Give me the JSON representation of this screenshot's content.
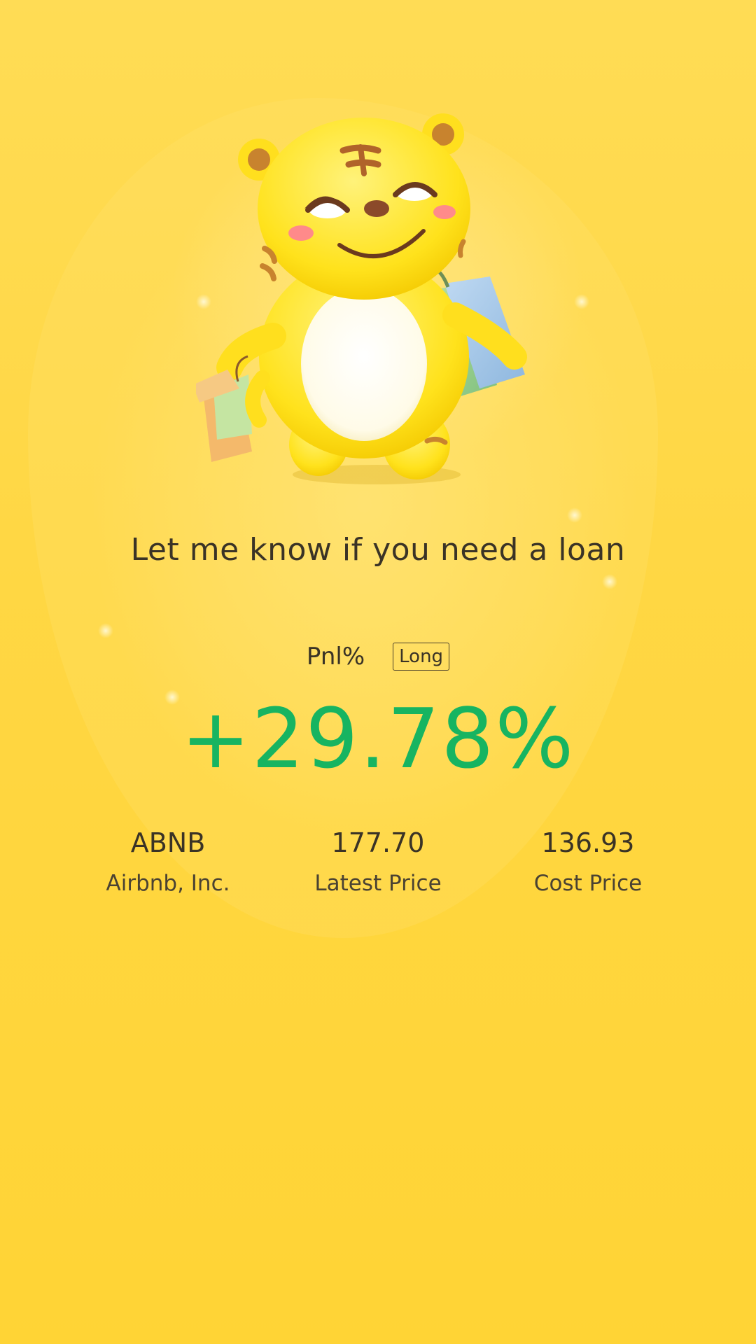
{
  "mascot": {
    "icon": "tiger-mascot-with-shopping-bags-icon"
  },
  "headline": "Let me know if you need a loan",
  "pnl": {
    "label": "Pnl%",
    "position_type": "Long",
    "value": "+29.78%",
    "value_color": "#17B461"
  },
  "stats": [
    {
      "value": "ABNB",
      "label": "Airbnb, Inc."
    },
    {
      "value": "177.70",
      "label": "Latest Price"
    },
    {
      "value": "136.93",
      "label": "Cost Price"
    }
  ],
  "colors": {
    "background": "#FFD43C",
    "text": "#3a3326",
    "positive": "#17B461"
  }
}
